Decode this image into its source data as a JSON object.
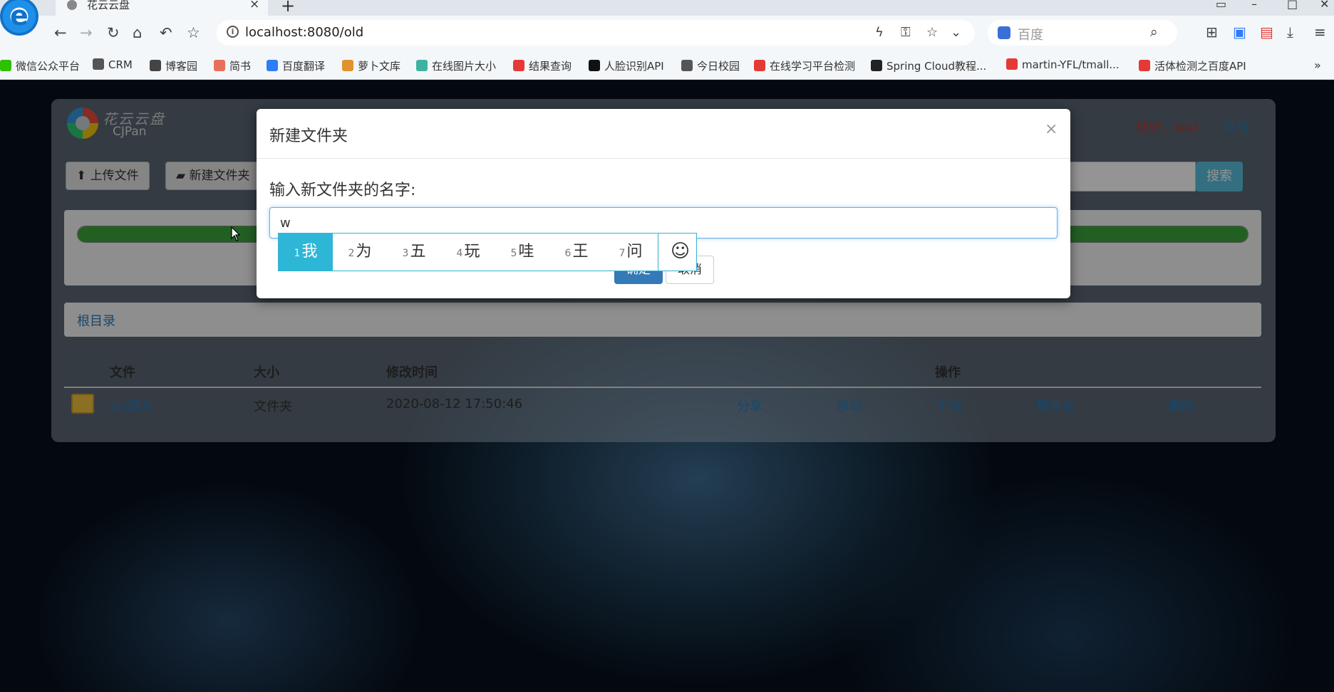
{
  "browser": {
    "tab_title": "花云云盘",
    "url": "localhost:8080/old",
    "search_placeholder": "百度",
    "bookmarks": [
      {
        "label": "微信公众平台",
        "color": "#2dc100"
      },
      {
        "label": "CRM",
        "color": "#555555"
      },
      {
        "label": "博客园",
        "color": "#444444"
      },
      {
        "label": "简书",
        "color": "#ea6f5a"
      },
      {
        "label": "百度翻译",
        "color": "#2f7cf6"
      },
      {
        "label": "萝卜文库",
        "color": "#e0922f"
      },
      {
        "label": "在线图片大小",
        "color": "#3bb3a0"
      },
      {
        "label": "结果查询",
        "color": "#e53935"
      },
      {
        "label": "人脸识别API",
        "color": "#111111"
      },
      {
        "label": "今日校园",
        "color": "#555555"
      },
      {
        "label": "在线学习平台检测",
        "color": "#e53935"
      },
      {
        "label": "Spring Cloud教程...",
        "color": "#222222"
      },
      {
        "label": "martin-YFL/tmall...",
        "color": "#e53935"
      },
      {
        "label": "活体检测之百度API",
        "color": "#e53935"
      }
    ]
  },
  "app": {
    "logo_cn": "花云云盘",
    "logo_en": "CJPan",
    "greeting": "您好，test",
    "logout": "退出",
    "upload_button": "上传文件",
    "new_folder_button": "新建文件夹",
    "search_button": "搜索",
    "upload_progress": 1.0,
    "breadcrumb": "根目录",
    "table": {
      "columns": [
        "文件",
        "大小",
        "修改时间",
        "操作"
      ],
      "rows": [
        {
          "name": "pic图片",
          "size": "文件夹",
          "modified": "2020-08-12 17:50:46",
          "actions": [
            "分享",
            "移动",
            "下载",
            "重命名",
            "删除"
          ]
        }
      ]
    }
  },
  "modal": {
    "title": "新建文件夹",
    "close": "×",
    "label": "输入新文件夹的名字:",
    "input_value": "w",
    "ok": "确定",
    "cancel": "取消"
  },
  "ime": {
    "candidates": [
      {
        "num": "1",
        "text": "我"
      },
      {
        "num": "2",
        "text": "为"
      },
      {
        "num": "3",
        "text": "五"
      },
      {
        "num": "4",
        "text": "玩"
      },
      {
        "num": "5",
        "text": "哇"
      },
      {
        "num": "6",
        "text": "王"
      },
      {
        "num": "7",
        "text": "问"
      }
    ],
    "emoji_icon": "smiley-icon"
  },
  "colors": {
    "accent": "#2eb6d6",
    "primary_button": "#337ab7",
    "link": "#2a7ab9",
    "progress": "#3ca63c"
  }
}
